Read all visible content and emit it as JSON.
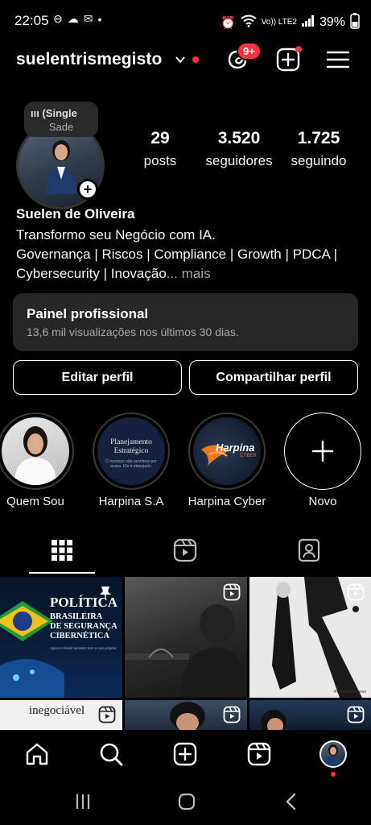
{
  "status_bar": {
    "time": "22:05",
    "network": "Vo)) LTE2",
    "battery": "39%"
  },
  "header": {
    "username": "suelentrismegisto",
    "threads_badge": "9+"
  },
  "profile": {
    "note_line1": "(Single",
    "note_line2": "Sade",
    "full_name": "Suelen de Oliveira",
    "bio_line1": "Transformo seu Negócio com IA.",
    "bio_line2": "Governança | Riscos | Compliance | Growth | PDCA |",
    "bio_line3": "Cybersecurity | Inovação",
    "bio_more": "... mais",
    "stats": [
      {
        "value": "29",
        "label": "posts"
      },
      {
        "value": "3.520",
        "label": "seguidores"
      },
      {
        "value": "1.725",
        "label": "seguindo"
      }
    ]
  },
  "panel": {
    "title": "Painel profissional",
    "subtitle": "13,6 mil visualizações nos últimos 30 dias."
  },
  "buttons": {
    "edit": "Editar perfil",
    "share": "Compartilhar perfil"
  },
  "highlights": [
    {
      "label": "Quem Sou"
    },
    {
      "label": "Harpina S.A",
      "cover_title": "Planejamento Estratégico",
      "cover_sub": "O sucesso não acontece por acaso. Ele é planejado."
    },
    {
      "label": "Harpina Cyber",
      "cover_title": "Harpina",
      "cover_sub": "CYBER"
    },
    {
      "label": "Novo"
    }
  ],
  "grid": {
    "post1_title": "POLÍTICA",
    "post1_line2": "BRASILEIRA",
    "post1_line3": "DE SEGURANÇA",
    "post1_line4": "CIBERNÉTICA",
    "post1_body": "Agora o Brasil também tem a sua própria",
    "post4_text": "inegociável",
    "post3_tag": "#harpinatechnews"
  },
  "colors": {
    "accent_red": "#ff3040",
    "panel_bg": "#262626",
    "muted_text": "#a8a8a8"
  }
}
